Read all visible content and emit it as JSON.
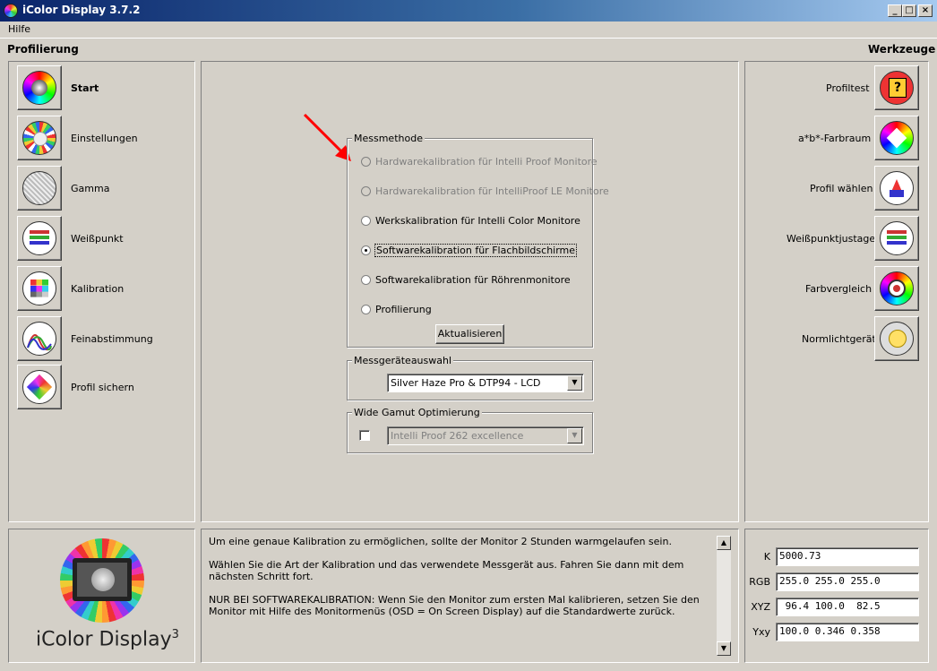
{
  "window": {
    "title": "iColor Display 3.7.2",
    "btn_min": "_",
    "btn_max": "□",
    "btn_close": "×"
  },
  "menu": {
    "help": "Hilfe"
  },
  "left": {
    "title": "Profilierung",
    "items": [
      {
        "label": "Start"
      },
      {
        "label": "Einstellungen"
      },
      {
        "label": "Gamma"
      },
      {
        "label": "Weißpunkt"
      },
      {
        "label": "Kalibration"
      },
      {
        "label": "Feinabstimmung"
      },
      {
        "label": "Profil sichern"
      }
    ]
  },
  "right": {
    "title": "Werkzeuge",
    "items": [
      {
        "label": "Profiltest"
      },
      {
        "label": "a*b*-Farbraum"
      },
      {
        "label": "Profil wählen"
      },
      {
        "label": "Weißpunktjustage"
      },
      {
        "label": "Farbvergleich"
      },
      {
        "label": "Normlichtgerät"
      }
    ]
  },
  "messmethode": {
    "title": "Messmethode",
    "options": [
      {
        "label": "Hardwarekalibration für Intelli Proof Monitore"
      },
      {
        "label": "Hardwarekalibration für IntelliProof LE Monitore"
      },
      {
        "label": "Werkskalibration für Intelli Color Monitore"
      },
      {
        "label": "Softwarekalibration für Flachbildschirme"
      },
      {
        "label": "Softwarekalibration für Röhrenmonitore"
      },
      {
        "label": "Profilierung"
      }
    ],
    "update_button": "Aktualisieren"
  },
  "device": {
    "title": "Messgeräteauswahl",
    "selected": "Silver Haze Pro & DTP94 - LCD"
  },
  "wide_gamut": {
    "title": "Wide Gamut Optimierung",
    "selected": "Intelli Proof 262 excellence"
  },
  "logo": {
    "text": "iColor Display",
    "sup": "3"
  },
  "info": {
    "p1": "Um eine genaue Kalibration zu ermöglichen, sollte der Monitor 2 Stunden warmgelaufen sein.",
    "p2": "Wählen Sie die Art der Kalibration und das verwendete Messgerät aus. Fahren Sie dann mit dem nächsten Schritt fort.",
    "p3": "NUR BEI SOFTWAREKALIBRATION: Wenn Sie den Monitor zum ersten Mal kalibrieren, setzen Sie den Monitor mit Hilfe des Monitormenüs (OSD = On Screen Display) auf die Standardwerte zurück."
  },
  "values": {
    "k_label": "K",
    "k": "5000.73",
    "rgb_label": "RGB",
    "rgb": "255.0 255.0 255.0",
    "xyz_label": "XYZ",
    "xyz": " 96.4 100.0  82.5",
    "yxy_label": "Yxy",
    "yxy": "100.0 0.346 0.358"
  },
  "icons": {
    "left": [
      "color-wheel-icon",
      "settings-wheel-icon",
      "gamma-grid-icon",
      "whitepoint-icon",
      "calibration-grid-icon",
      "curves-icon",
      "save-profile-icon"
    ],
    "right": [
      "profile-test-icon",
      "ab-colorspace-icon",
      "choose-profile-icon",
      "whitepoint-adjust-icon",
      "color-compare-icon",
      "normlight-icon"
    ]
  },
  "colors": {
    "titlebar_start": "#0a246a",
    "titlebar_end": "#a6caf0",
    "face": "#d4d0c8",
    "annotation_arrow": "#ff0000"
  }
}
